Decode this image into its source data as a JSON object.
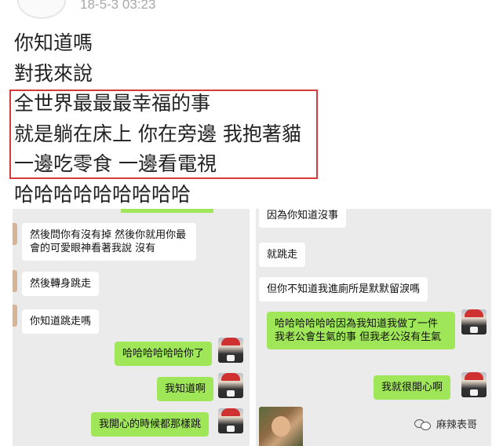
{
  "post": {
    "timestamp": "18-5-3 03:23",
    "lines": [
      "你知道嗎",
      "對我來說",
      "全世界最最最幸福的事",
      "就是躺在床上 你在旁邊 我抱著貓",
      "一邊吃零食 一邊看電視",
      "哈哈哈哈哈哈哈哈哈"
    ]
  },
  "left_chat": {
    "messages": [
      {
        "side": "left",
        "text": "然後問你有沒有掉 然後你就用你最會的可愛眼神看著我說 沒有"
      },
      {
        "side": "left",
        "text": "然後轉身跳走"
      },
      {
        "side": "left",
        "text": "你知道跳走嗎"
      },
      {
        "side": "right",
        "text": "哈哈哈哈哈哈你了"
      },
      {
        "side": "right",
        "text": "我知道啊"
      },
      {
        "side": "right",
        "text": "我開心的時候都那樣跳"
      }
    ]
  },
  "right_chat": {
    "messages": [
      {
        "side": "left",
        "text": "因為你知道沒事"
      },
      {
        "side": "left",
        "text": "就跳走"
      },
      {
        "side": "left",
        "text": "但你不知道我進廁所是默默留淚嗎"
      },
      {
        "side": "right",
        "text": "哈哈哈哈哈哈因為我知道我做了一件我老公會生氣的事 但我老公沒有生氣"
      },
      {
        "side": "right",
        "text": "我就很開心啊"
      }
    ]
  },
  "watermark": {
    "text": "麻辣表哥",
    "icon": "wechat-icon"
  },
  "colors": {
    "green_bubble": "#9fe658",
    "highlight_border": "#d63a3a",
    "chat_bg": "#ebebeb"
  }
}
